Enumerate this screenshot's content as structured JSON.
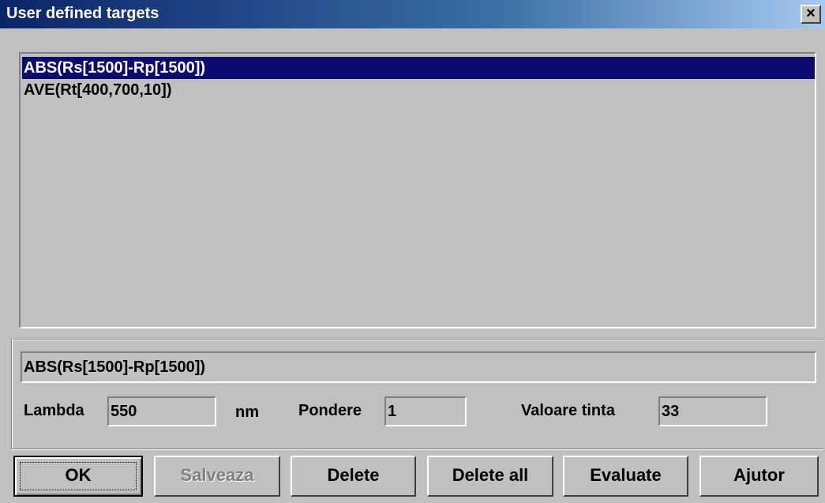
{
  "window": {
    "title": "User defined targets",
    "close_glyph": "×",
    "close_icon": "close-icon"
  },
  "targets_list": {
    "items": [
      {
        "label": "ABS(Rs[1500]-Rp[1500])",
        "selected": true
      },
      {
        "label": "AVE(Rt[400,700,10])",
        "selected": false
      }
    ]
  },
  "expression_field": {
    "value": "ABS(Rs[1500]-Rp[1500])"
  },
  "lambda": {
    "label": "Lambda",
    "value": "550",
    "unit": "nm"
  },
  "pondere": {
    "label": "Pondere",
    "value": "1"
  },
  "valoare_tinta": {
    "label": "Valoare tinta",
    "value": "33"
  },
  "buttons": {
    "ok": "OK",
    "salveaza": "Salveaza",
    "delete": "Delete",
    "delete_all": "Delete all",
    "evaluate": "Evaluate",
    "ajutor": "Ajutor"
  },
  "colors": {
    "selection": "#0a0a72",
    "title_start": "#0a246a",
    "title_end": "#a6caf0",
    "face": "#c0c0c0"
  }
}
